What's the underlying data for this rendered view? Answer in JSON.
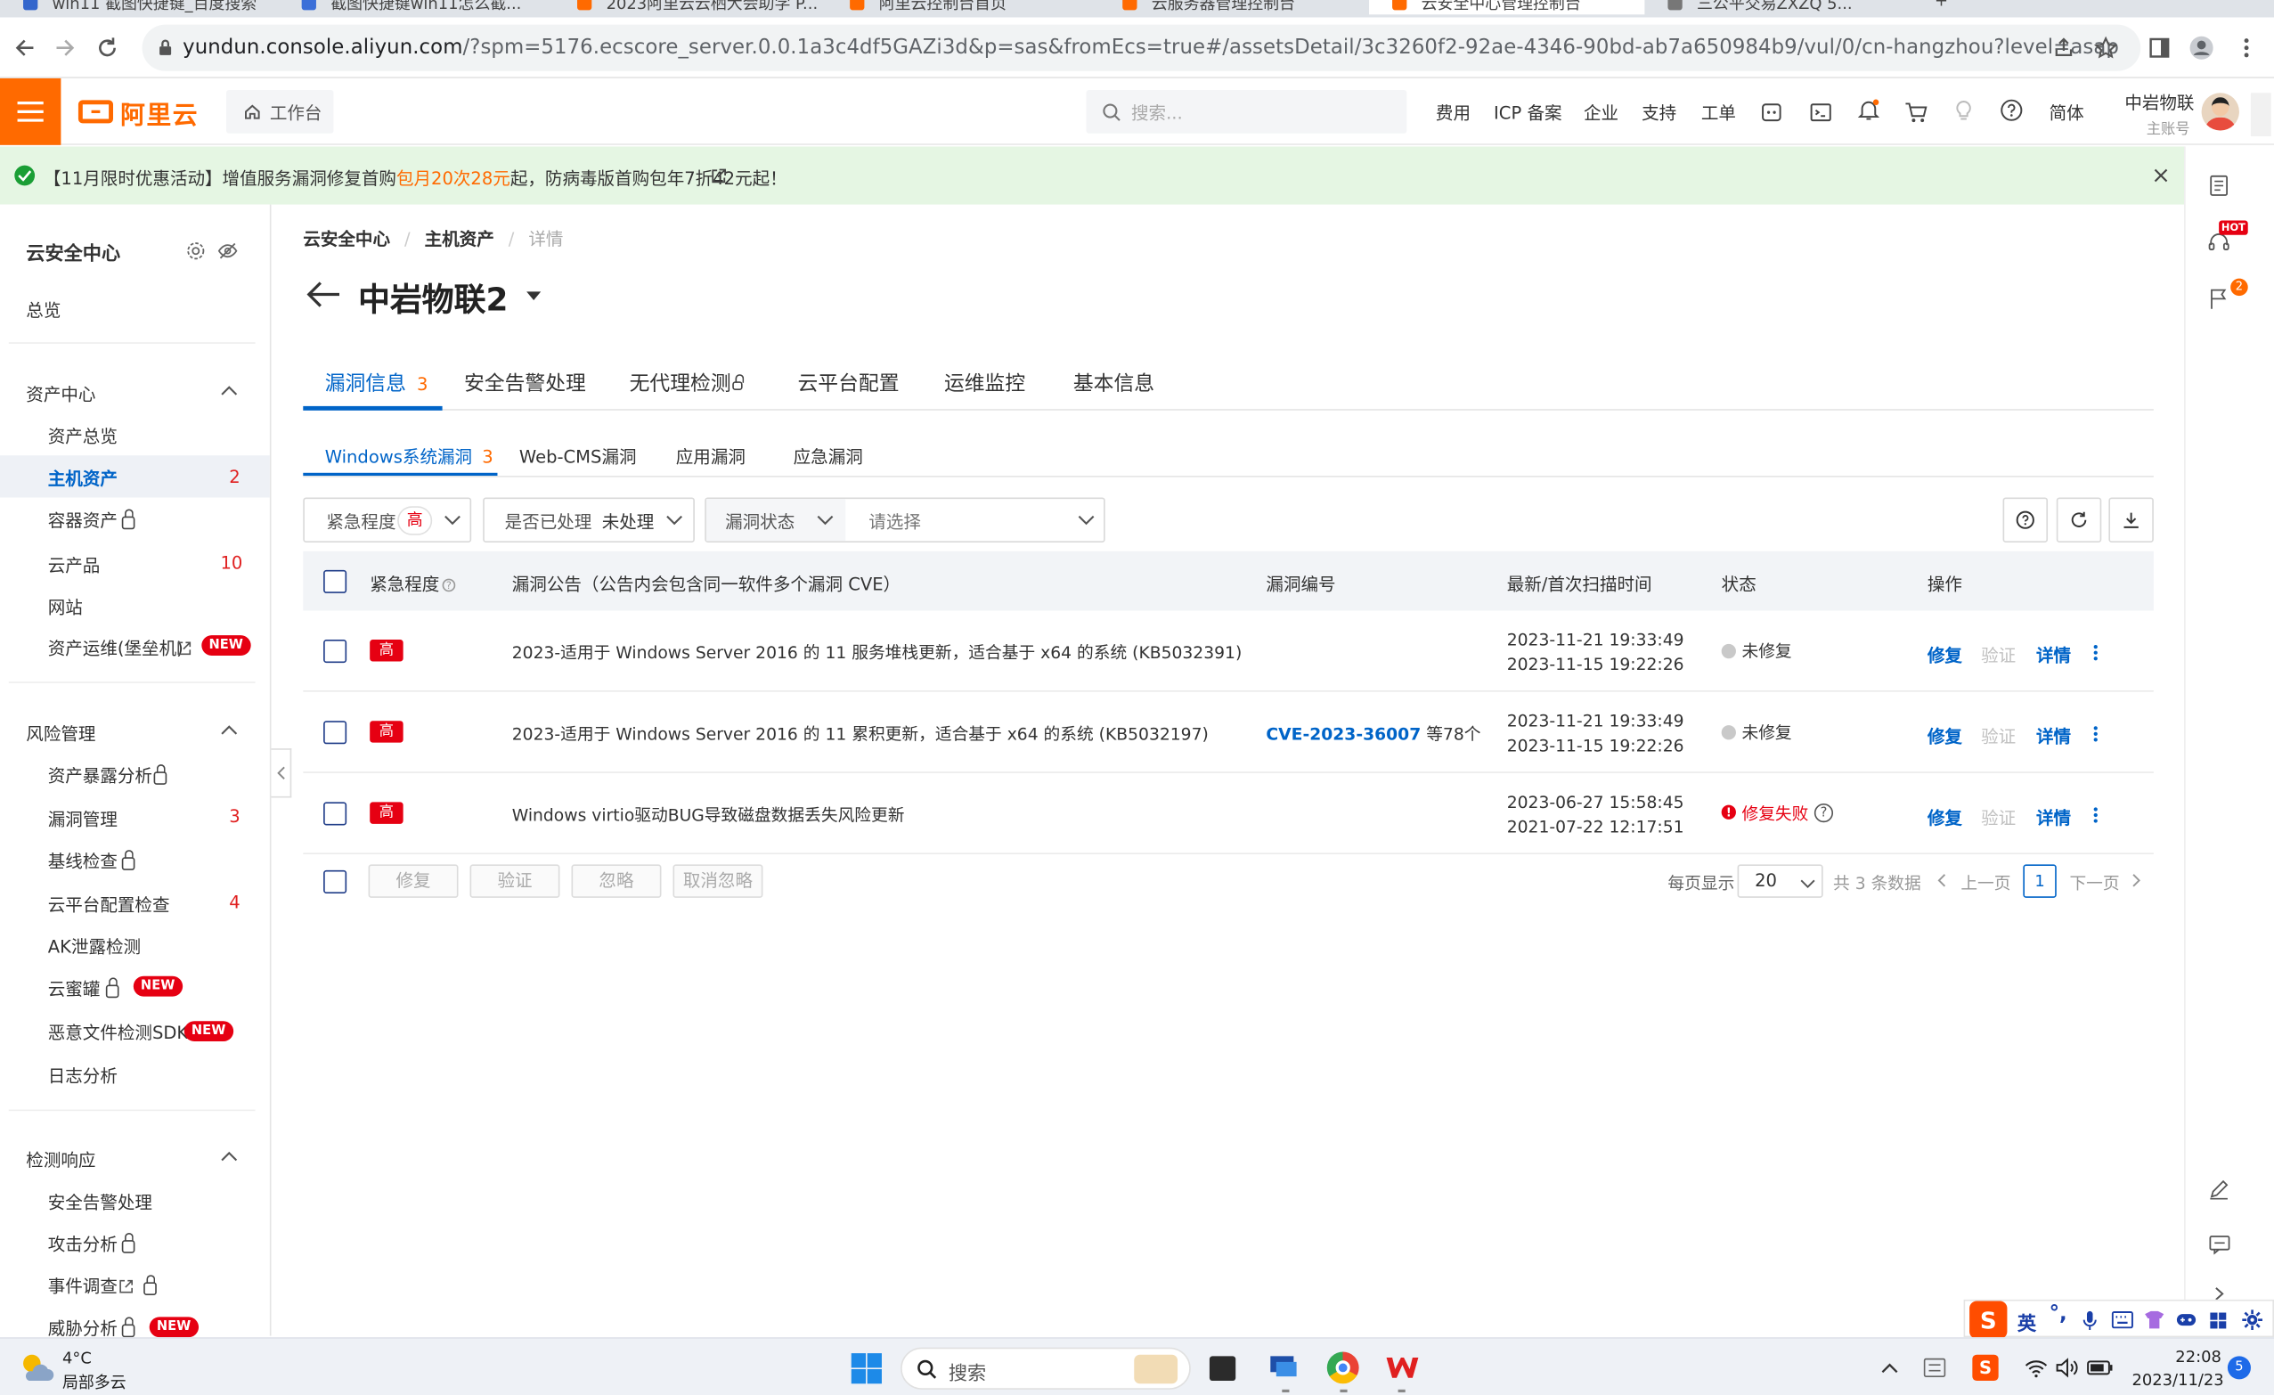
{
  "browser": {
    "tabs": [
      "win11 截图快捷键_百度搜索",
      "截图快捷键win11怎么截...",
      "2023阿里云云栖大会助学 P...",
      "阿里云控制台首页",
      "云服务器管理控制台",
      "云安全中心管理控制台",
      "三公平交易ZXZQ 5...",
      "+"
    ],
    "url_host": "yundun.console.aliyun.com",
    "url_path": "/?spm=5176.ecscore_server.0.0.1a3c4df5GAZi3d&p=sas&fromEcs=true#/assetsDetail/3c3260f2-92ae-4346-90bd-ab7a650984b9/vul/0/cn-hangzhou?level=asap"
  },
  "topbar": {
    "logo": "阿里云",
    "workbench": "工作台",
    "search_placeholder": "搜索...",
    "nav": [
      "费用",
      "ICP 备案",
      "企业",
      "支持",
      "工单"
    ],
    "lang": "简体",
    "user_name": "中岩物联",
    "user_role": "主账号"
  },
  "banner": {
    "prefix": "【11月限时优惠活动】增值服务漏洞修复首购",
    "highlight": "包月20次28元",
    "suffix": "起，防病毒版首购包年7折42元起！"
  },
  "sidebar": {
    "title": "云安全中心",
    "overview": "总览",
    "groups": [
      {
        "label": "资产中心",
        "items": [
          {
            "label": "资产总览",
            "count": ""
          },
          {
            "label": "主机资产",
            "count": "2",
            "active": true
          },
          {
            "label": "容器资产",
            "count": "",
            "lock": true
          },
          {
            "label": "云产品",
            "count": "10"
          },
          {
            "label": "网站",
            "count": ""
          },
          {
            "label": "资产运维(堡垒机)",
            "count": "",
            "external": true,
            "new": true
          }
        ]
      },
      {
        "label": "风险管理",
        "items": [
          {
            "label": "资产暴露分析",
            "lock": true
          },
          {
            "label": "漏洞管理",
            "count": "3"
          },
          {
            "label": "基线检查",
            "lock": true
          },
          {
            "label": "云平台配置检查",
            "count": "4"
          },
          {
            "label": "AK泄露检测"
          },
          {
            "label": "云蜜罐",
            "lock": true,
            "new": true
          },
          {
            "label": "恶意文件检测SDK",
            "new": true
          },
          {
            "label": "日志分析"
          }
        ]
      },
      {
        "label": "检测响应",
        "items": [
          {
            "label": "安全告警处理"
          },
          {
            "label": "攻击分析",
            "lock": true
          },
          {
            "label": "事件调查",
            "external": true,
            "lock": true
          },
          {
            "label": "威胁分析",
            "lock": true,
            "new": true
          }
        ]
      }
    ],
    "new_badge": "NEW"
  },
  "breadcrumb": [
    "云安全中心",
    "主机资产",
    "详情"
  ],
  "page_title": "中岩物联2",
  "tabs": [
    {
      "label": "漏洞信息",
      "count": "3"
    },
    {
      "label": "安全告警处理"
    },
    {
      "label": "无代理检测"
    },
    {
      "label": "云平台配置"
    },
    {
      "label": "运维监控"
    },
    {
      "label": "基本信息"
    }
  ],
  "subtabs": [
    {
      "label": "Windows系统漏洞",
      "count": "3"
    },
    {
      "label": "Web-CMS漏洞"
    },
    {
      "label": "应用漏洞"
    },
    {
      "label": "应急漏洞"
    }
  ],
  "filters": {
    "severity_label": "紧急程度",
    "severity_value": "高",
    "handled_label": "是否已处理",
    "handled_value": "未处理",
    "status_label": "漏洞状态",
    "status_placeholder": "请选择"
  },
  "table": {
    "headers": [
      "紧急程度",
      "漏洞公告（公告内会包含同一软件多个漏洞 CVE）",
      "漏洞编号",
      "最新/首次扫描时间",
      "状态",
      "操作"
    ],
    "rows": [
      {
        "severity": "高",
        "title": "2023-适用于 Windows Server 2016 的 11 服务堆栈更新，适合基于 x64 的系统 (KB5032391)",
        "cve": "",
        "cve_more": "",
        "latest": "2023-11-21 19:33:49",
        "first": "2023-11-15 19:22:26",
        "status": "未修复",
        "status_type": "unfixed"
      },
      {
        "severity": "高",
        "title": "2023-适用于 Windows Server 2016 的 11 累积更新，适合基于 x64 的系统 (KB5032197)",
        "cve": "CVE-2023-36007",
        "cve_more": "等78个",
        "latest": "2023-11-21 19:33:49",
        "first": "2023-11-15 19:22:26",
        "status": "未修复",
        "status_type": "unfixed"
      },
      {
        "severity": "高",
        "title": "Windows virtio驱动BUG导致磁盘数据丢失风险更新",
        "cve": "",
        "cve_more": "",
        "latest": "2023-06-27 15:58:45",
        "first": "2021-07-22 12:17:51",
        "status": "修复失败",
        "status_type": "failed"
      }
    ],
    "actions": {
      "fix": "修复",
      "verify": "验证",
      "detail": "详情"
    }
  },
  "footer": {
    "buttons": [
      "修复",
      "验证",
      "忽略",
      "取消忽略"
    ],
    "page_size_label": "每页显示",
    "page_size": "20",
    "total": "共 3 条数据",
    "prev": "上一页",
    "page": "1",
    "next": "下一页"
  },
  "taskbar": {
    "weather_temp": "4°C",
    "weather_desc": "局部多云",
    "search": "搜索",
    "ime": "英",
    "time": "22:08",
    "date": "2023/11/23",
    "notif": "5"
  },
  "right_rail": {
    "hot": "HOT",
    "badge": "2"
  },
  "colors": {
    "accent": "#0064c8",
    "brand": "#ff6a00",
    "danger": "#e60012",
    "banner_bg": "#e5f6e3"
  }
}
